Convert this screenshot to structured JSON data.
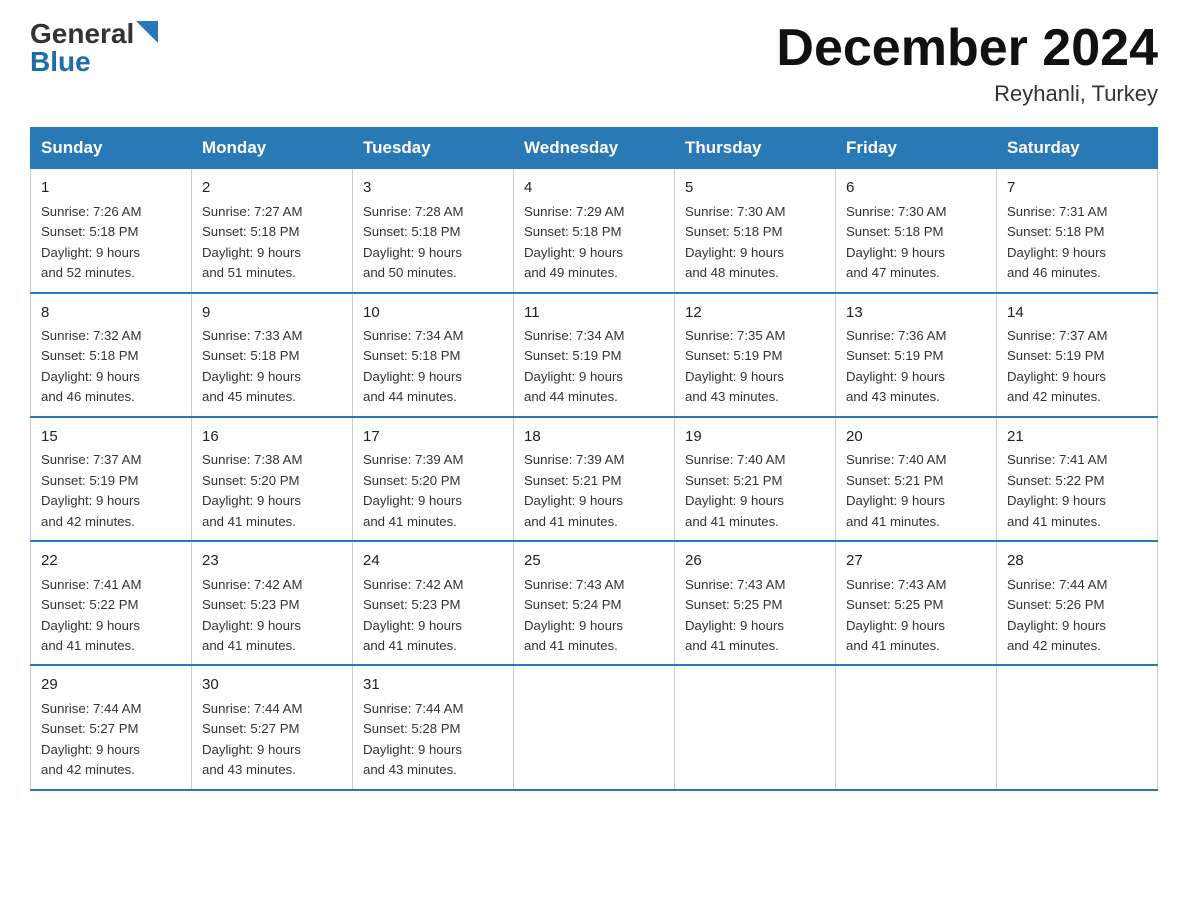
{
  "logo": {
    "general": "General",
    "blue": "Blue"
  },
  "title": "December 2024",
  "subtitle": "Reyhanli, Turkey",
  "days_of_week": [
    "Sunday",
    "Monday",
    "Tuesday",
    "Wednesday",
    "Thursday",
    "Friday",
    "Saturday"
  ],
  "weeks": [
    [
      {
        "day": "1",
        "sunrise": "7:26 AM",
        "sunset": "5:18 PM",
        "daylight": "9 hours and 52 minutes."
      },
      {
        "day": "2",
        "sunrise": "7:27 AM",
        "sunset": "5:18 PM",
        "daylight": "9 hours and 51 minutes."
      },
      {
        "day": "3",
        "sunrise": "7:28 AM",
        "sunset": "5:18 PM",
        "daylight": "9 hours and 50 minutes."
      },
      {
        "day": "4",
        "sunrise": "7:29 AM",
        "sunset": "5:18 PM",
        "daylight": "9 hours and 49 minutes."
      },
      {
        "day": "5",
        "sunrise": "7:30 AM",
        "sunset": "5:18 PM",
        "daylight": "9 hours and 48 minutes."
      },
      {
        "day": "6",
        "sunrise": "7:30 AM",
        "sunset": "5:18 PM",
        "daylight": "9 hours and 47 minutes."
      },
      {
        "day": "7",
        "sunrise": "7:31 AM",
        "sunset": "5:18 PM",
        "daylight": "9 hours and 46 minutes."
      }
    ],
    [
      {
        "day": "8",
        "sunrise": "7:32 AM",
        "sunset": "5:18 PM",
        "daylight": "9 hours and 46 minutes."
      },
      {
        "day": "9",
        "sunrise": "7:33 AM",
        "sunset": "5:18 PM",
        "daylight": "9 hours and 45 minutes."
      },
      {
        "day": "10",
        "sunrise": "7:34 AM",
        "sunset": "5:18 PM",
        "daylight": "9 hours and 44 minutes."
      },
      {
        "day": "11",
        "sunrise": "7:34 AM",
        "sunset": "5:19 PM",
        "daylight": "9 hours and 44 minutes."
      },
      {
        "day": "12",
        "sunrise": "7:35 AM",
        "sunset": "5:19 PM",
        "daylight": "9 hours and 43 minutes."
      },
      {
        "day": "13",
        "sunrise": "7:36 AM",
        "sunset": "5:19 PM",
        "daylight": "9 hours and 43 minutes."
      },
      {
        "day": "14",
        "sunrise": "7:37 AM",
        "sunset": "5:19 PM",
        "daylight": "9 hours and 42 minutes."
      }
    ],
    [
      {
        "day": "15",
        "sunrise": "7:37 AM",
        "sunset": "5:19 PM",
        "daylight": "9 hours and 42 minutes."
      },
      {
        "day": "16",
        "sunrise": "7:38 AM",
        "sunset": "5:20 PM",
        "daylight": "9 hours and 41 minutes."
      },
      {
        "day": "17",
        "sunrise": "7:39 AM",
        "sunset": "5:20 PM",
        "daylight": "9 hours and 41 minutes."
      },
      {
        "day": "18",
        "sunrise": "7:39 AM",
        "sunset": "5:21 PM",
        "daylight": "9 hours and 41 minutes."
      },
      {
        "day": "19",
        "sunrise": "7:40 AM",
        "sunset": "5:21 PM",
        "daylight": "9 hours and 41 minutes."
      },
      {
        "day": "20",
        "sunrise": "7:40 AM",
        "sunset": "5:21 PM",
        "daylight": "9 hours and 41 minutes."
      },
      {
        "day": "21",
        "sunrise": "7:41 AM",
        "sunset": "5:22 PM",
        "daylight": "9 hours and 41 minutes."
      }
    ],
    [
      {
        "day": "22",
        "sunrise": "7:41 AM",
        "sunset": "5:22 PM",
        "daylight": "9 hours and 41 minutes."
      },
      {
        "day": "23",
        "sunrise": "7:42 AM",
        "sunset": "5:23 PM",
        "daylight": "9 hours and 41 minutes."
      },
      {
        "day": "24",
        "sunrise": "7:42 AM",
        "sunset": "5:23 PM",
        "daylight": "9 hours and 41 minutes."
      },
      {
        "day": "25",
        "sunrise": "7:43 AM",
        "sunset": "5:24 PM",
        "daylight": "9 hours and 41 minutes."
      },
      {
        "day": "26",
        "sunrise": "7:43 AM",
        "sunset": "5:25 PM",
        "daylight": "9 hours and 41 minutes."
      },
      {
        "day": "27",
        "sunrise": "7:43 AM",
        "sunset": "5:25 PM",
        "daylight": "9 hours and 41 minutes."
      },
      {
        "day": "28",
        "sunrise": "7:44 AM",
        "sunset": "5:26 PM",
        "daylight": "9 hours and 42 minutes."
      }
    ],
    [
      {
        "day": "29",
        "sunrise": "7:44 AM",
        "sunset": "5:27 PM",
        "daylight": "9 hours and 42 minutes."
      },
      {
        "day": "30",
        "sunrise": "7:44 AM",
        "sunset": "5:27 PM",
        "daylight": "9 hours and 43 minutes."
      },
      {
        "day": "31",
        "sunrise": "7:44 AM",
        "sunset": "5:28 PM",
        "daylight": "9 hours and 43 minutes."
      },
      null,
      null,
      null,
      null
    ]
  ]
}
